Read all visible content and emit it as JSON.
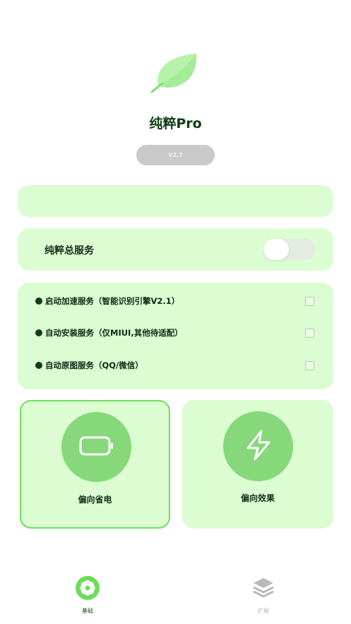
{
  "app": {
    "title": "纯粹Pro",
    "version": "V2.7",
    "logo_icon": "leaf-icon",
    "accent_color": "#86d87a"
  },
  "notice": {
    "text": ""
  },
  "master_service": {
    "label": "纯粹总服务",
    "enabled": false
  },
  "options": [
    {
      "label": "启动加速服务（智能识别引擎V2.1）",
      "checked": false
    },
    {
      "label": "自动安装服务（仅MIUI,其他待适配）",
      "checked": false
    },
    {
      "label": "自动原图服务（QQ/微信）",
      "checked": false
    }
  ],
  "modes": {
    "power_saving": {
      "label": "偏向省电",
      "icon": "battery-icon",
      "selected": true
    },
    "performance": {
      "label": "偏向效果",
      "icon": "lightning-icon",
      "selected": false
    }
  },
  "bottom_nav": {
    "home": {
      "label": "基础",
      "icon": "flower-icon",
      "active": true
    },
    "extension": {
      "label": "扩展",
      "icon": "layers-icon",
      "active": false
    }
  }
}
